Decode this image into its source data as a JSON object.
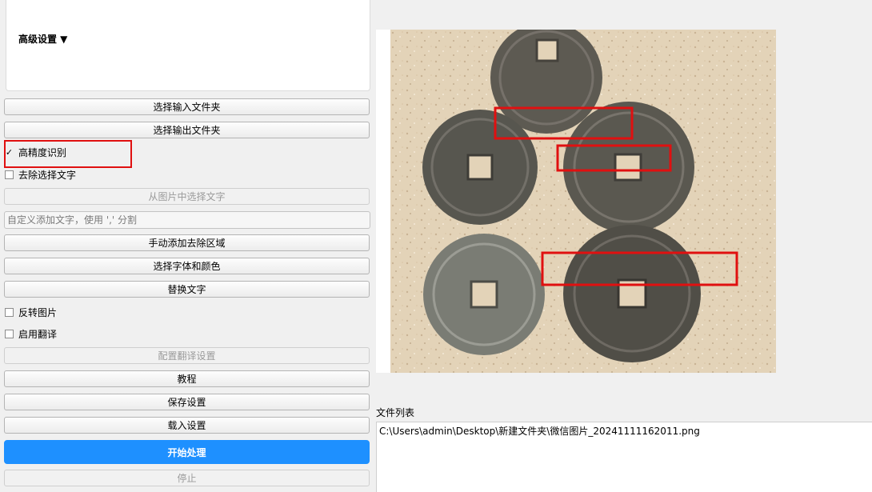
{
  "advanced": {
    "title": "高级设置 ▼"
  },
  "buttons": {
    "select_input": "选择输入文件夹",
    "select_output": "选择输出文件夹",
    "pick_text": "从图片中选择文字",
    "manual_region": "手动添加去除区域",
    "font_color": "选择字体和颜色",
    "replace_text": "替换文字",
    "translate_settings": "配置翻译设置",
    "tutorial": "教程",
    "save_settings": "保存设置",
    "load_settings": "载入设置",
    "start": "开始处理",
    "stop": "停止"
  },
  "checkboxes": {
    "high_precision": {
      "label": "高精度识别",
      "checked": true,
      "mark": "✓"
    },
    "remove_selected": {
      "label": "去除选择文字",
      "checked": false
    },
    "flip_image": {
      "label": "反转图片",
      "checked": false
    },
    "enable_translate": {
      "label": "启用翻译",
      "checked": false
    }
  },
  "custom_text": {
    "placeholder": "自定义添加文字，使用 ',' 分割"
  },
  "file_list": {
    "label": "文件列表",
    "items": [
      "C:\\Users\\admin\\Desktop\\新建文件夹\\微信图片_20241111162011.png"
    ]
  },
  "colors": {
    "accent": "#1e90ff",
    "highlight_red": "#e01010"
  }
}
